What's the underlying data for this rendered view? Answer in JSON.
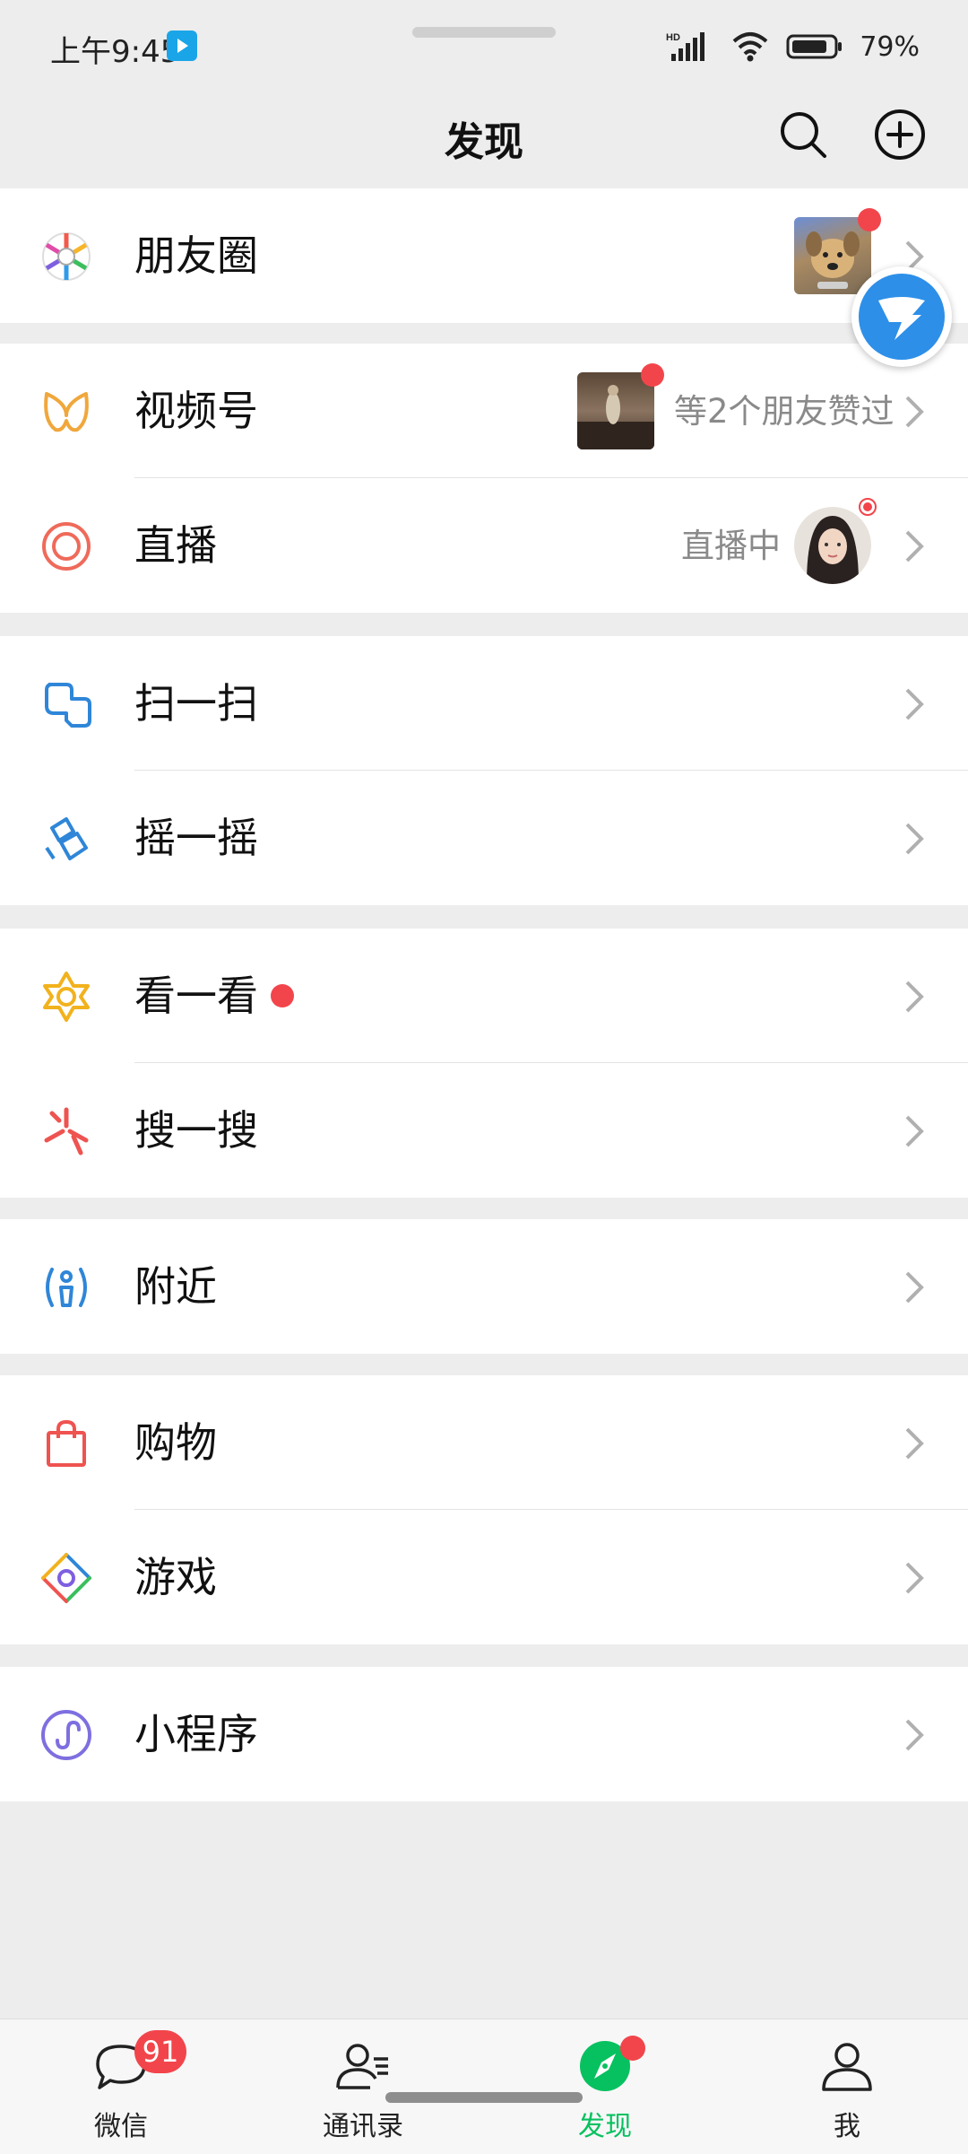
{
  "status_bar": {
    "time": "上午9:45",
    "battery_text": "79%",
    "network": "HD"
  },
  "header": {
    "title": "发现"
  },
  "rows": {
    "moments": {
      "label": "朋友圈",
      "icon": "moments-icon"
    },
    "channels": {
      "label": "视频号",
      "right_text": "等2个朋友赞过",
      "icon": "channels-icon"
    },
    "live": {
      "label": "直播",
      "right_text": "直播中",
      "icon": "live-icon"
    },
    "scan": {
      "label": "扫一扫",
      "icon": "scan-icon"
    },
    "shake": {
      "label": "摇一摇",
      "icon": "shake-icon"
    },
    "top_stories": {
      "label": "看一看",
      "icon": "top-stories-icon"
    },
    "search": {
      "label": "搜一搜",
      "icon": "search-feature-icon"
    },
    "nearby": {
      "label": "附近",
      "icon": "nearby-icon"
    },
    "shopping": {
      "label": "购物",
      "icon": "shopping-bag-icon"
    },
    "games": {
      "label": "游戏",
      "icon": "games-icon"
    },
    "mini_programs": {
      "label": "小程序",
      "icon": "mini-program-icon"
    }
  },
  "tab_bar": {
    "tabs": [
      {
        "label": "微信",
        "badge": "91",
        "icon": "chat-icon"
      },
      {
        "label": "通讯录",
        "icon": "contacts-icon"
      },
      {
        "label": "发现",
        "icon": "discover-icon",
        "active": true
      },
      {
        "label": "我",
        "icon": "me-icon"
      }
    ]
  },
  "colors": {
    "accent_green": "#07c160",
    "badge_red": "#f2454b",
    "background": "#ededed"
  }
}
